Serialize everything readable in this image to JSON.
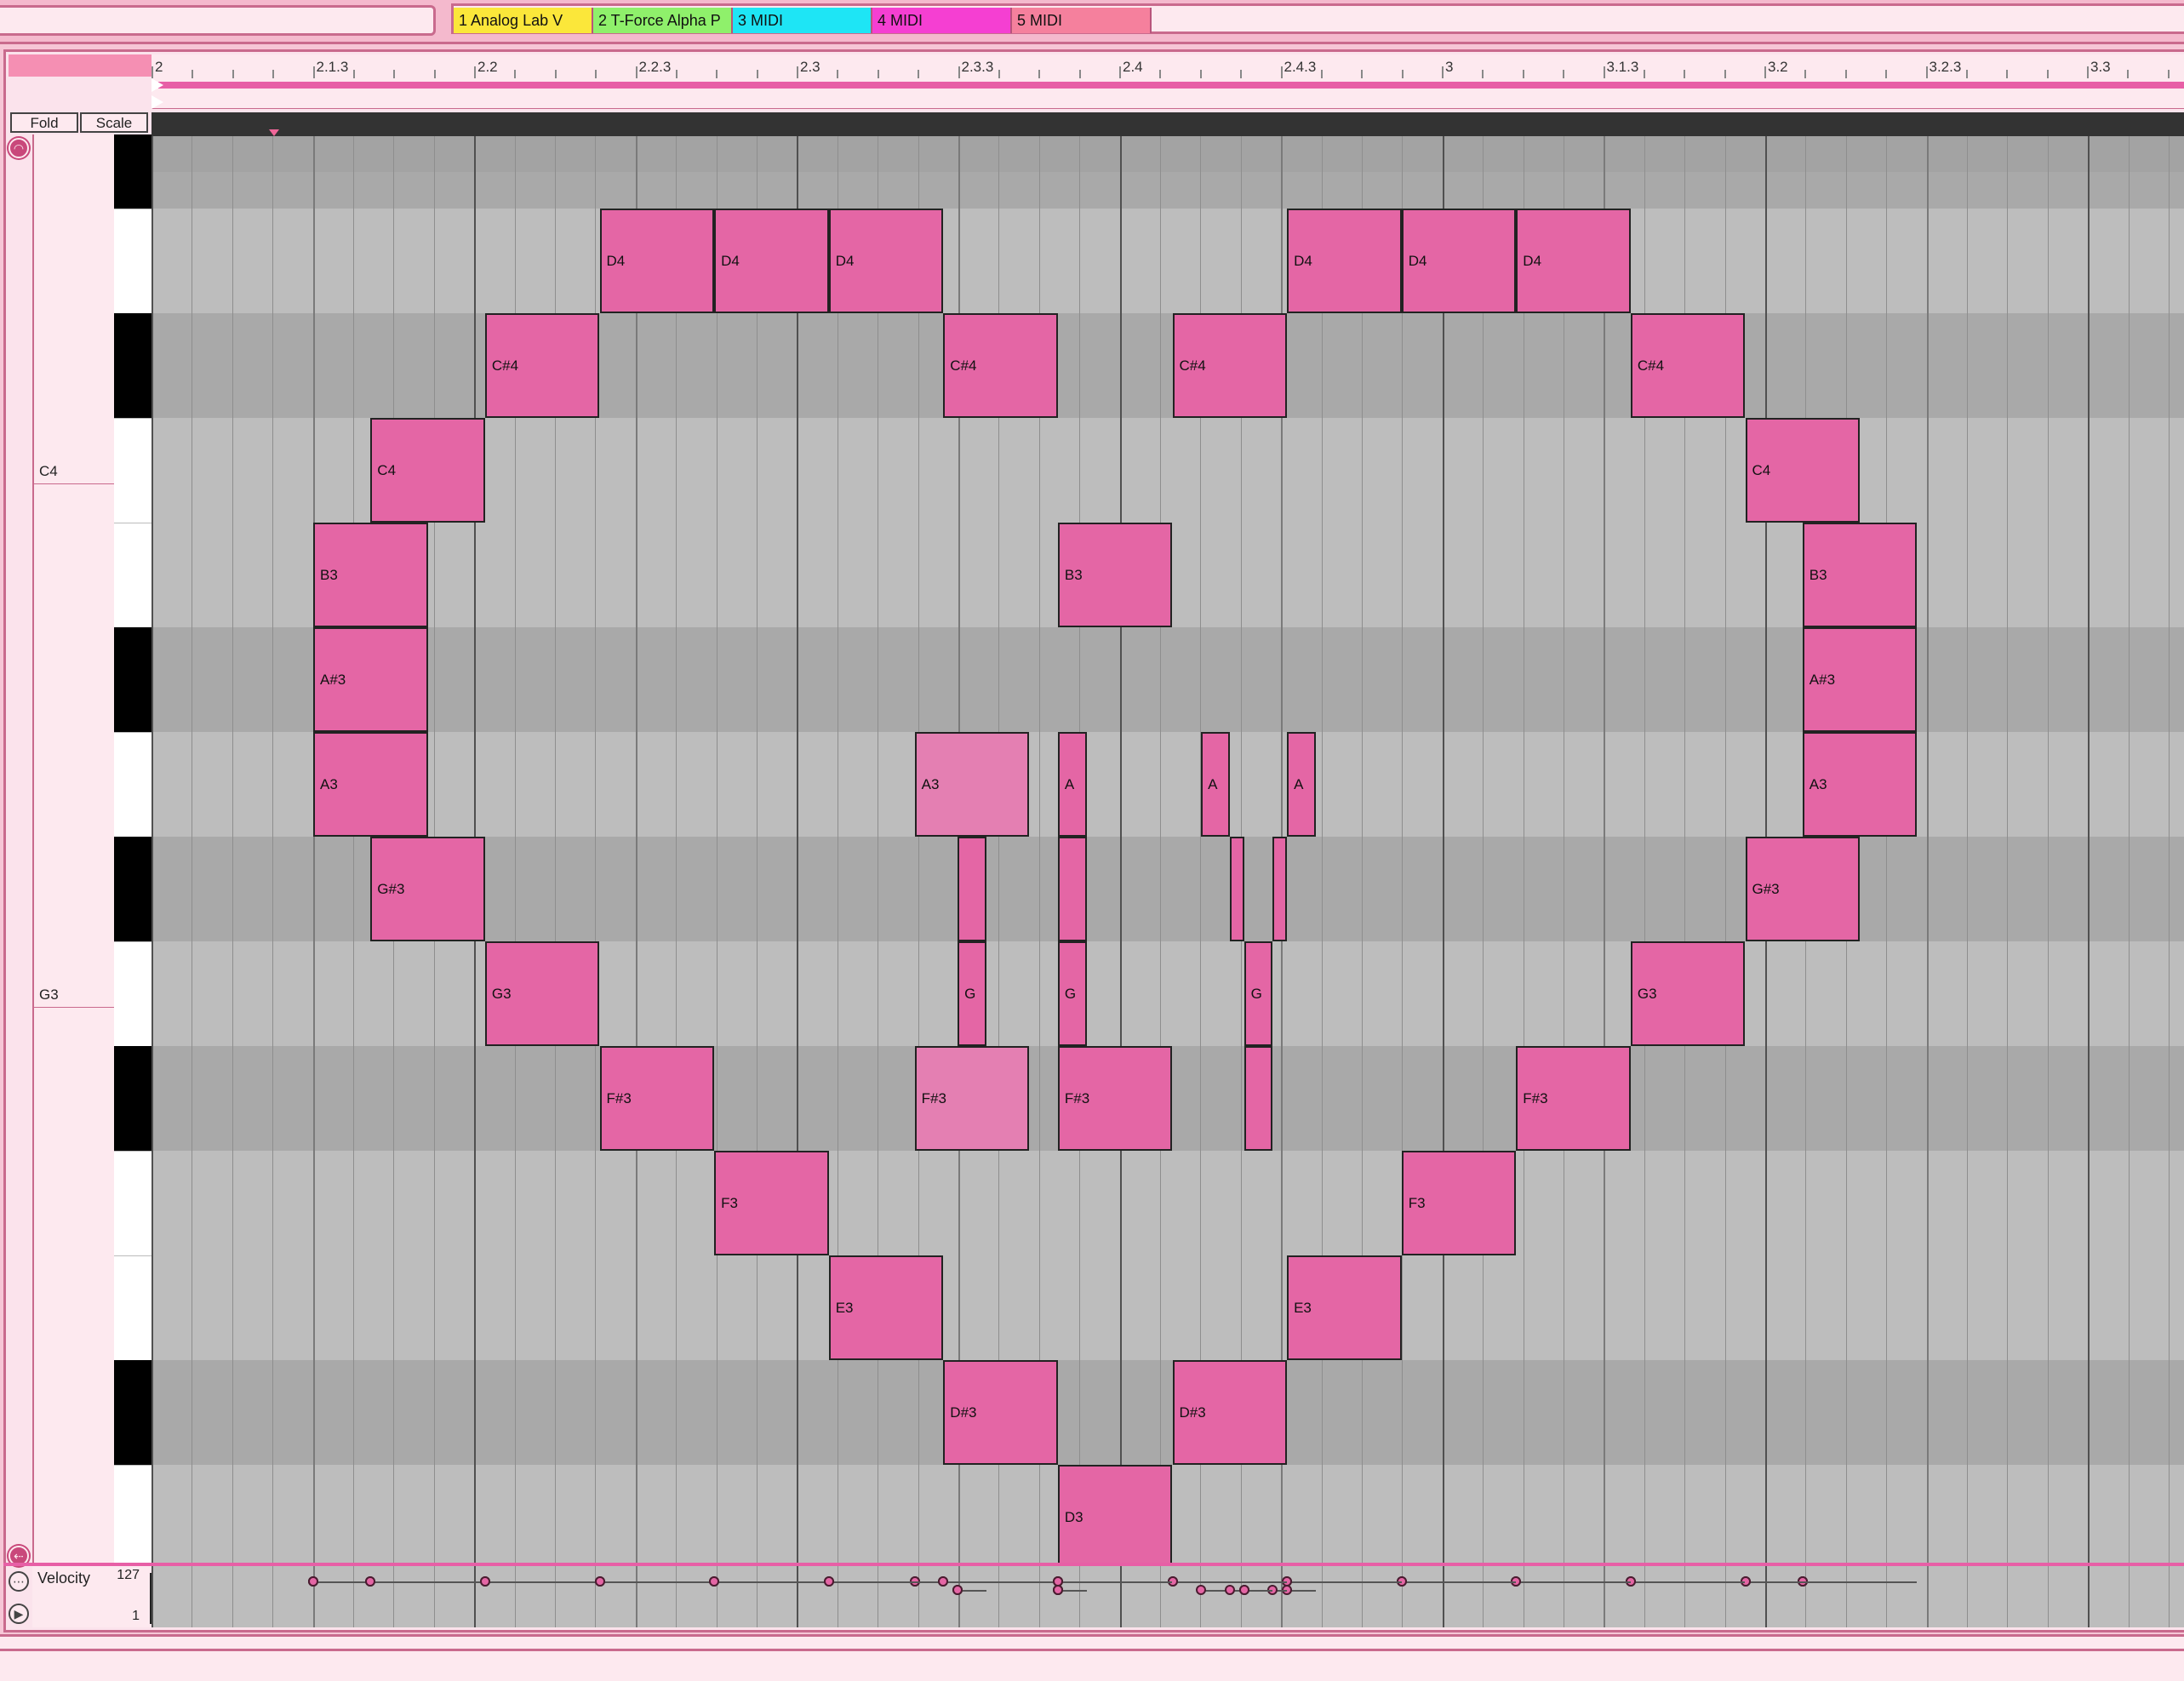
{
  "window": {
    "tracks": [
      {
        "label": "1 Analog Lab V",
        "color": "#fbe73a"
      },
      {
        "label": "2 T-Force Alpha P",
        "color": "#8ff06b"
      },
      {
        "label": "3 MIDI",
        "color": "#1ee5f5"
      },
      {
        "label": "4 MIDI",
        "color": "#f53fd2"
      },
      {
        "label": "5 MIDI",
        "color": "#f5809d"
      }
    ]
  },
  "ruler": {
    "labels": [
      "2",
      "2.1.3",
      "2.2",
      "2.2.3",
      "2.3",
      "2.3.3",
      "2.4",
      "2.4.3",
      "3",
      "3.1.3",
      "3.2",
      "3.2.3",
      "3.3"
    ]
  },
  "controls": {
    "fold_label": "Fold",
    "scale_label": "Scale"
  },
  "keyboard": {
    "octave_labels": [
      "C4",
      "G3"
    ]
  },
  "velocity": {
    "label": "Velocity",
    "max": "127",
    "min": "1"
  },
  "notes": [
    {
      "pitch": "D4",
      "start": 4,
      "length": 1,
      "row": 1
    },
    {
      "pitch": "D4",
      "start": 5,
      "length": 1,
      "row": 1
    },
    {
      "pitch": "D4",
      "start": 6,
      "length": 1,
      "row": 1
    },
    {
      "pitch": "D4",
      "start": 10,
      "length": 1,
      "row": 1
    },
    {
      "pitch": "D4",
      "start": 11,
      "length": 1,
      "row": 1
    },
    {
      "pitch": "D4",
      "start": 12,
      "length": 1,
      "row": 1
    },
    {
      "pitch": "C#4",
      "start": 3,
      "length": 1,
      "row": 2
    },
    {
      "pitch": "C#4",
      "start": 7,
      "length": 1,
      "row": 2
    },
    {
      "pitch": "C#4",
      "start": 9,
      "length": 1,
      "row": 2
    },
    {
      "pitch": "C#4",
      "start": 13,
      "length": 1,
      "row": 2
    },
    {
      "pitch": "C4",
      "start": 2,
      "length": 1,
      "row": 3
    },
    {
      "pitch": "C4",
      "start": 14,
      "length": 1,
      "row": 3
    },
    {
      "pitch": "B3",
      "start": 1.5,
      "length": 1,
      "row": 4
    },
    {
      "pitch": "B3",
      "start": 8,
      "length": 1,
      "row": 4
    },
    {
      "pitch": "B3",
      "start": 14.5,
      "length": 1,
      "row": 4
    },
    {
      "pitch": "A#3",
      "start": 1.5,
      "length": 1,
      "row": 5
    },
    {
      "pitch": "A#3",
      "start": 14.5,
      "length": 1,
      "row": 5
    },
    {
      "pitch": "A3",
      "start": 1.5,
      "length": 1,
      "row": 6
    },
    {
      "pitch": "A3",
      "start": 6.75,
      "length": 1,
      "row": 6,
      "light": true
    },
    {
      "pitch": "A",
      "start": 8,
      "length": 0.25,
      "row": 6
    },
    {
      "pitch": "A",
      "start": 9.25,
      "length": 0.25,
      "row": 6
    },
    {
      "pitch": "A",
      "start": 10,
      "length": 0.25,
      "row": 6
    },
    {
      "pitch": "A3",
      "start": 14.5,
      "length": 1,
      "row": 6
    },
    {
      "pitch": "G#3",
      "start": 2,
      "length": 1,
      "row": 7
    },
    {
      "pitch": "",
      "start": 7.125,
      "length": 0.25,
      "row": 7
    },
    {
      "pitch": "",
      "start": 8,
      "length": 0.25,
      "row": 7
    },
    {
      "pitch": "",
      "start": 9.5,
      "length": 0.125,
      "row": 7
    },
    {
      "pitch": "",
      "start": 9.875,
      "length": 0.125,
      "row": 7
    },
    {
      "pitch": "G#3",
      "start": 14,
      "length": 1,
      "row": 7
    },
    {
      "pitch": "G3",
      "start": 3,
      "length": 1,
      "row": 8
    },
    {
      "pitch": "G",
      "start": 7.125,
      "length": 0.25,
      "row": 8
    },
    {
      "pitch": "G",
      "start": 8,
      "length": 0.25,
      "row": 8
    },
    {
      "pitch": "G",
      "start": 9.625,
      "length": 0.25,
      "row": 8
    },
    {
      "pitch": "G3",
      "start": 13,
      "length": 1,
      "row": 8
    },
    {
      "pitch": "F#3",
      "start": 4,
      "length": 1,
      "row": 9
    },
    {
      "pitch": "F#3",
      "start": 6.75,
      "length": 1,
      "row": 9,
      "light": true
    },
    {
      "pitch": "F#3",
      "start": 8,
      "length": 1,
      "row": 9
    },
    {
      "pitch": "",
      "start": 9.625,
      "length": 0.25,
      "row": 9
    },
    {
      "pitch": "F#3",
      "start": 12,
      "length": 1,
      "row": 9
    },
    {
      "pitch": "F3",
      "start": 5,
      "length": 1,
      "row": 10
    },
    {
      "pitch": "F3",
      "start": 11,
      "length": 1,
      "row": 10
    },
    {
      "pitch": "E3",
      "start": 6,
      "length": 1,
      "row": 11
    },
    {
      "pitch": "E3",
      "start": 10,
      "length": 1,
      "row": 11
    },
    {
      "pitch": "D#3",
      "start": 7,
      "length": 1,
      "row": 12
    },
    {
      "pitch": "D#3",
      "start": 9,
      "length": 1,
      "row": 12
    },
    {
      "pitch": "D3",
      "start": 8,
      "length": 1,
      "row": 13
    }
  ],
  "colors": {
    "note": "#e466a5",
    "note_light": "#e47fb2",
    "accent": "#e75fa6"
  }
}
